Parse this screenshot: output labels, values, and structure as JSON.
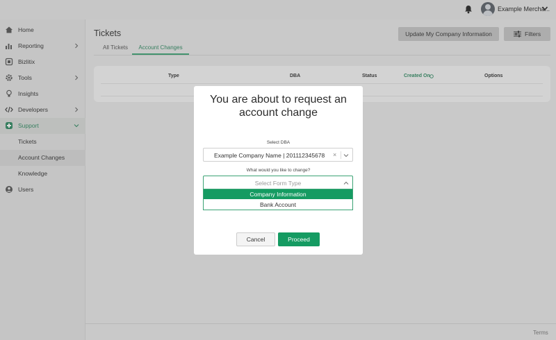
{
  "header": {
    "user_name": "Example Mercha...",
    "icons": [
      "bell-icon",
      "avatar",
      "chevron-down-icon"
    ]
  },
  "sidebar": {
    "items": [
      {
        "label": "Home",
        "icon": "home-icon"
      },
      {
        "label": "Reporting",
        "icon": "chart-icon",
        "has_chevron": true
      },
      {
        "label": "Bizlitix",
        "icon": "bizlitix-icon"
      },
      {
        "label": "Tools",
        "icon": "gear-icon",
        "has_chevron": true
      },
      {
        "label": "Insights",
        "icon": "lightbulb-icon"
      },
      {
        "label": "Developers",
        "icon": "code-icon",
        "has_chevron": true
      },
      {
        "label": "Support",
        "icon": "support-icon",
        "expanded": true
      },
      {
        "label": "Tickets"
      },
      {
        "label": "Account Changes",
        "current": true
      },
      {
        "label": "Knowledge"
      },
      {
        "label": "Users",
        "icon": "user-icon"
      }
    ]
  },
  "main": {
    "title": "Tickets",
    "update_button": "Update My Company Information",
    "filters_button": "Filters",
    "tabs": [
      {
        "label": "All Tickets"
      },
      {
        "label": "Account Changes",
        "active": true
      }
    ],
    "table_headers": [
      "Type",
      "DBA",
      "Status",
      "Created On",
      "Options"
    ]
  },
  "footer": {
    "terms": "Terms"
  },
  "modal": {
    "title": "You are about to request an account change",
    "dba_label": "Select DBA",
    "dba_value": "Example Company Name | 201112345678",
    "change_label": "What would you like to change?",
    "form_placeholder": "Select Form Type",
    "options": [
      "Company Information",
      "Bank Account"
    ],
    "cancel": "Cancel",
    "proceed": "Proceed"
  },
  "colors": {
    "accent": "#159b62",
    "accent_text": "#2f8a62"
  }
}
